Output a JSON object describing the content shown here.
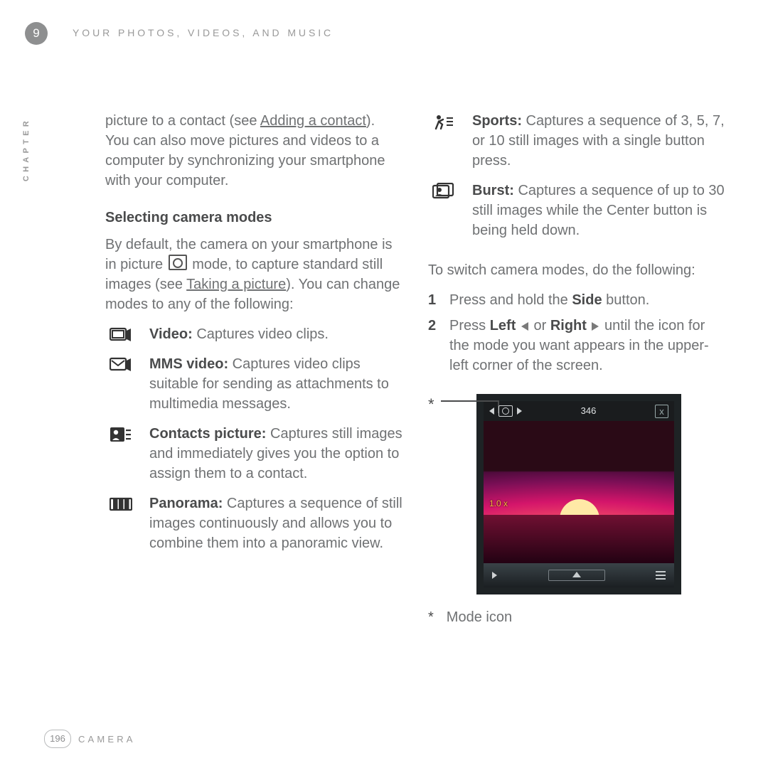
{
  "chapter": {
    "num": "9",
    "side_label": "CHAPTER",
    "running_head": "YOUR PHOTOS, VIDEOS, AND MUSIC"
  },
  "footer": {
    "page_num": "196",
    "section": "CAMERA"
  },
  "left": {
    "intro_pre": "picture to a contact (see ",
    "intro_link": "Adding a contact",
    "intro_post": "). You can also move pictures and videos to a computer by synchronizing your smartphone with your computer.",
    "heading": "Selecting camera modes",
    "para2_pre": "By default, the camera on your smartphone is in picture ",
    "para2_mid": " mode, to capture standard still images (see ",
    "para2_link": "Taking a picture",
    "para2_post": "). You can change modes to any of the following:",
    "modes": {
      "video": {
        "name": "Video:",
        "desc": " Captures video clips."
      },
      "mms": {
        "name": "MMS video:",
        "desc": " Captures video clips suitable for sending as attachments to multimedia messages."
      },
      "contacts": {
        "name": "Contacts picture:",
        "desc": " Captures still images and immediately gives you the option to assign them to a contact."
      },
      "pano": {
        "name": "Panorama:",
        "desc": " Captures a sequence of still images continuously and allows you to combine them into a panoramic view."
      }
    }
  },
  "right": {
    "modes": {
      "sports": {
        "name": "Sports:",
        "desc": " Captures a sequence of 3, 5, 7, or 10 still images with a single button press."
      },
      "burst": {
        "name": "Burst:",
        "desc": " Captures a sequence of up to 30 still images while the Center button is being held down."
      }
    },
    "switch_intro": "To switch camera modes, do the following:",
    "steps": {
      "s1_num": "1",
      "s1_a": "Press and hold the ",
      "s1_b": "Side",
      "s1_c": " button.",
      "s2_num": "2",
      "s2_a": "Press ",
      "s2_left": "Left",
      "s2_or": " or ",
      "s2_right": "Right",
      "s2_b": " until the icon for the mode you want appears in the upper-left corner of the screen."
    },
    "shot": {
      "counter": "346",
      "zoom": "1.0 x",
      "close": "x"
    },
    "footnote_mark": "*",
    "footnote_text": "Mode icon"
  }
}
